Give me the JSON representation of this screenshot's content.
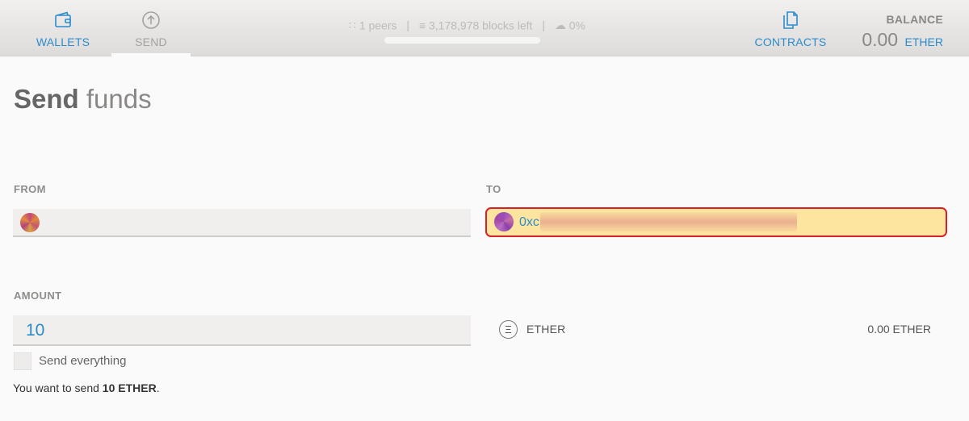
{
  "nav": {
    "wallets": {
      "label": "WALLETS",
      "icon": "wallet-icon"
    },
    "send": {
      "label": "SEND",
      "icon": "arrow-up-circle-icon"
    },
    "contracts": {
      "label": "CONTRACTS",
      "icon": "documents-icon"
    }
  },
  "status": {
    "peers": "1 peers",
    "blocks": "3,178,978 blocks left",
    "sync": "0%",
    "sync_progress": 0
  },
  "balance": {
    "title": "BALANCE",
    "value": "0.00",
    "unit": "ETHER"
  },
  "page": {
    "title_strong": "Send",
    "title_light": "funds"
  },
  "form": {
    "from_label": "FROM",
    "to_label": "TO",
    "to_value": "0xc",
    "amount_label": "AMOUNT",
    "amount_value": "10",
    "send_everything_label": "Send everything",
    "currency_label": "ETHER",
    "currency_symbol": "Ξ",
    "currency_balance": "0.00 ETHER",
    "summary_prefix": "You want to send",
    "summary_amount": "10 ETHER",
    "summary_suffix": "."
  },
  "colors": {
    "accent": "#2b8ccd",
    "highlight_border": "#d6202a",
    "highlight_fill": "#fde5a0"
  }
}
